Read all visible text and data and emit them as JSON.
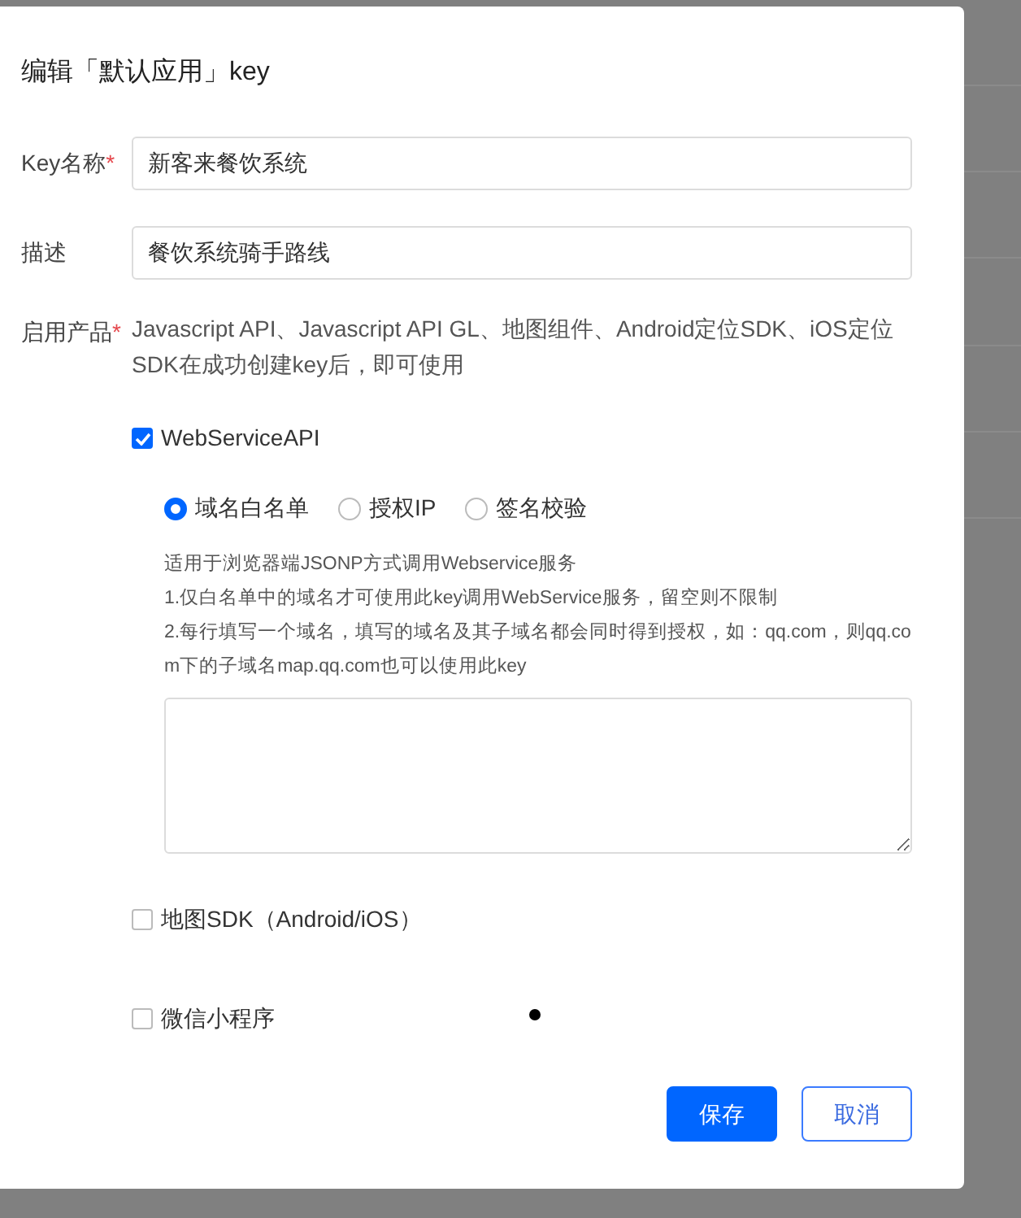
{
  "dialog": {
    "title": "编辑「默认应用」key",
    "fields": [
      {
        "label": "Key名称",
        "required_mark": "*",
        "value": "新客来餐饮系统"
      },
      {
        "label": "描述",
        "value": "餐饮系统骑手路线"
      }
    ],
    "products": {
      "label": "启用产品",
      "required_mark": "*",
      "note": "Javascript API、Javascript API GL、地图组件、Android定位SDK、iOS定位SDK在成功创建key后，即可使用",
      "options": [
        {
          "label": "WebServiceAPI",
          "checked": true,
          "modes": [
            {
              "label": "域名白名单",
              "selected": true
            },
            {
              "label": "授权IP",
              "selected": false
            },
            {
              "label": "签名校验",
              "selected": false
            }
          ],
          "help": [
            "适用于浏览器端JSONP方式调用Webservice服务",
            "1.仅白名单中的域名才可使用此key调用WebService服务，留空则不限制",
            "2.每行填写一个域名，填写的域名及其子域名都会同时得到授权，如：qq.com，则qq.com下的子域名map.qq.com也可以使用此key"
          ]
        },
        {
          "label": "地图SDK（Android/iOS）",
          "checked": false
        },
        {
          "label": "微信小程序",
          "checked": false
        }
      ]
    },
    "buttons": [
      {
        "label": "保存",
        "kind": "primary"
      },
      {
        "label": "取消",
        "kind": "secondary"
      }
    ]
  }
}
